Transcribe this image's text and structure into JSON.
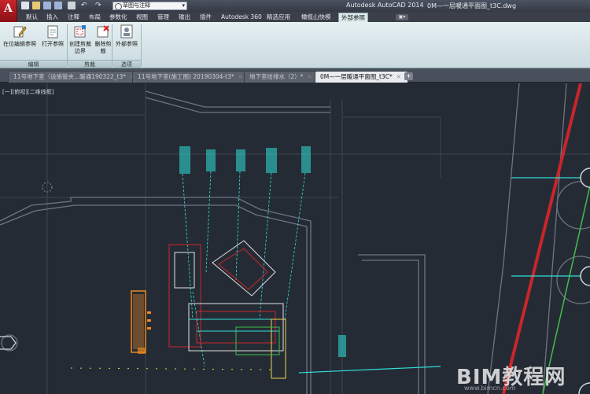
{
  "titlebar": {
    "workspace": "草图与注释",
    "app_title": "Autodesk AutoCAD 2014",
    "file_title": "0M—一层暖通平面图_t3C.dwg"
  },
  "ribbon_tabs": [
    "默认",
    "插入",
    "注释",
    "布局",
    "参数化",
    "视图",
    "管理",
    "输出",
    "插件",
    "Autodesk 360",
    "精选应用",
    "橄榄山快模",
    "外部参照"
  ],
  "active_tab": "外部参照",
  "ribbon": {
    "groups": [
      {
        "label": "编辑",
        "buttons": [
          "在位编辑参照",
          "打开参照"
        ]
      },
      {
        "label": "剪裁",
        "buttons": [
          "创建剪裁边界",
          "删除剪裁"
        ]
      },
      {
        "label": "选项",
        "buttons": [
          "外部参照"
        ]
      }
    ]
  },
  "doc_tabs": [
    {
      "label": "11号地下室（设施管夹...暖通190322_t3*"
    },
    {
      "label": "11号地下室(施工图) 20190304-t3*"
    },
    {
      "label": "地下室给排水（2）*"
    },
    {
      "label": "0M—一层暖通平面图_t3C*",
      "active": true
    }
  ],
  "canvas": {
    "view_label": "[一][俯视][二维线框]",
    "watermark": "BIM教程网",
    "watermark_url": "www.bimcn.com",
    "accent_colors": {
      "background": "#252b35",
      "cyan": "#2fe0d8",
      "orange": "#f08a1e",
      "red": "#c8262b",
      "green": "#3fbf4a"
    }
  }
}
